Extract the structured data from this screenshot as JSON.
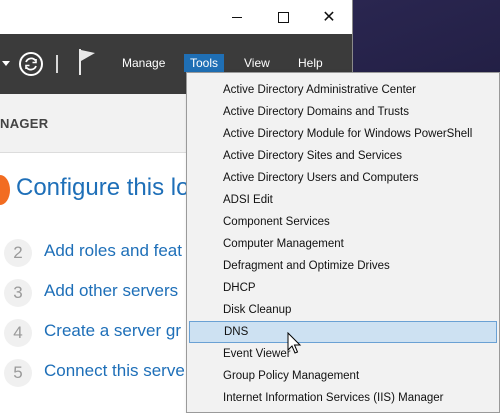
{
  "window": {
    "caption": {
      "minimize": "—",
      "maximize": "",
      "close": "✕"
    },
    "menubar": {
      "items": [
        {
          "label": "Manage"
        },
        {
          "label": "Tools",
          "active": true
        },
        {
          "label": "View"
        },
        {
          "label": "Help"
        }
      ]
    },
    "header_title": "NAGER"
  },
  "main": {
    "configure_title": "Configure this lo",
    "steps": [
      {
        "num": "2",
        "label": "Add roles and feat"
      },
      {
        "num": "3",
        "label": "Add other servers"
      },
      {
        "num": "4",
        "label": "Create a server gr"
      },
      {
        "num": "5",
        "label": "Connect this serve"
      }
    ]
  },
  "tools_menu": {
    "items": [
      "Active Directory Administrative Center",
      "Active Directory Domains and Trusts",
      "Active Directory Module for Windows PowerShell",
      "Active Directory Sites and Services",
      "Active Directory Users and Computers",
      "ADSI Edit",
      "Component Services",
      "Computer Management",
      "Defragment and Optimize Drives",
      "DHCP",
      "Disk Cleanup",
      "DNS",
      "Event Viewer",
      "Group Policy Management",
      "Internet Information Services (IIS) Manager"
    ],
    "highlighted": "DNS"
  },
  "colors": {
    "menubar_bg": "#3b3b3b",
    "accent_blue": "#1f6fb5",
    "link_blue": "#1e6fb8",
    "orange": "#f26c21",
    "highlight_bg": "#cde1f2"
  }
}
